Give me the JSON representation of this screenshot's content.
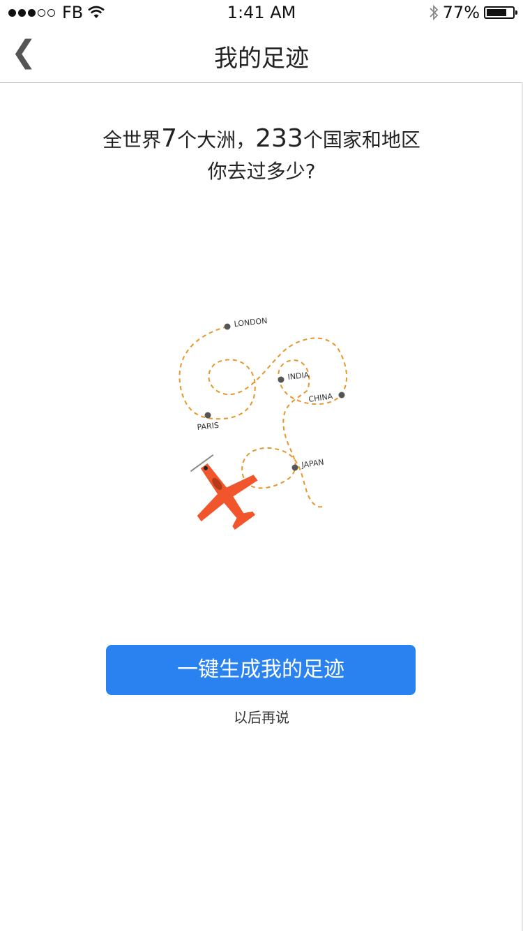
{
  "status_bar": {
    "carrier": "FB",
    "time": "1:41 AM",
    "battery_percent": "77%",
    "battery_level": 0.77,
    "signal_bars_filled": 3,
    "signal_bars_total": 5
  },
  "nav": {
    "title": "我的足迹",
    "back_icon": "chevron-left-icon",
    "back_glyph": "❮"
  },
  "intro": {
    "part1": "全世界",
    "continents": "7",
    "part2": "个大洲，",
    "countries": "233",
    "part3": "个国家和地区",
    "line2": "你去过多少?"
  },
  "map": {
    "cities": [
      "LONDON",
      "INDIA",
      "CHINA",
      "PARIS",
      "JAPAN"
    ],
    "route_color": "#e6962a",
    "marker_color": "#555555",
    "plane_color": "#f0552c"
  },
  "actions": {
    "generate_label": "一键生成我的足迹",
    "later_label": "以后再说"
  },
  "colors": {
    "accent": "#2a82f0"
  }
}
